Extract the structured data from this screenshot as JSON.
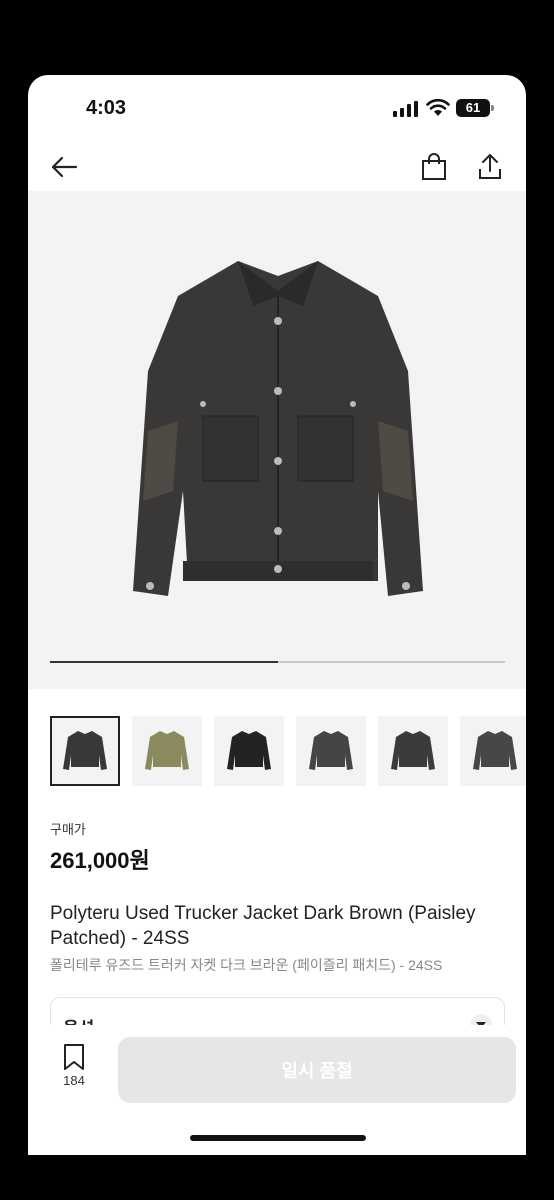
{
  "status_bar": {
    "time": "4:03",
    "battery": "61"
  },
  "nav": {
    "back_icon": "arrow-left-icon",
    "bag_icon": "shopping-bag-icon",
    "share_icon": "share-icon"
  },
  "gallery": {
    "progress_fraction": 0.5,
    "thumb_count": 6,
    "active_thumb": 0
  },
  "product": {
    "price_label": "구매가",
    "price": "261,000원",
    "title": "Polyteru Used Trucker Jacket Dark Brown (Paisley Patched) - 24SS",
    "subtitle": "폴리테루 유즈드 트러커 자켓 다크 브라운 (페이즐리 패치드) - 24SS"
  },
  "option": {
    "label": "옵션",
    "caret_icon": "chevron-down-icon"
  },
  "bottom": {
    "wish_icon": "bookmark-icon",
    "wish_count": "184",
    "cta_label": "일시 품절"
  },
  "colors": {
    "jacket": "#3a3836",
    "thumb_camo": "#8a8a5e",
    "cta_disabled": "#e6e6e6"
  }
}
